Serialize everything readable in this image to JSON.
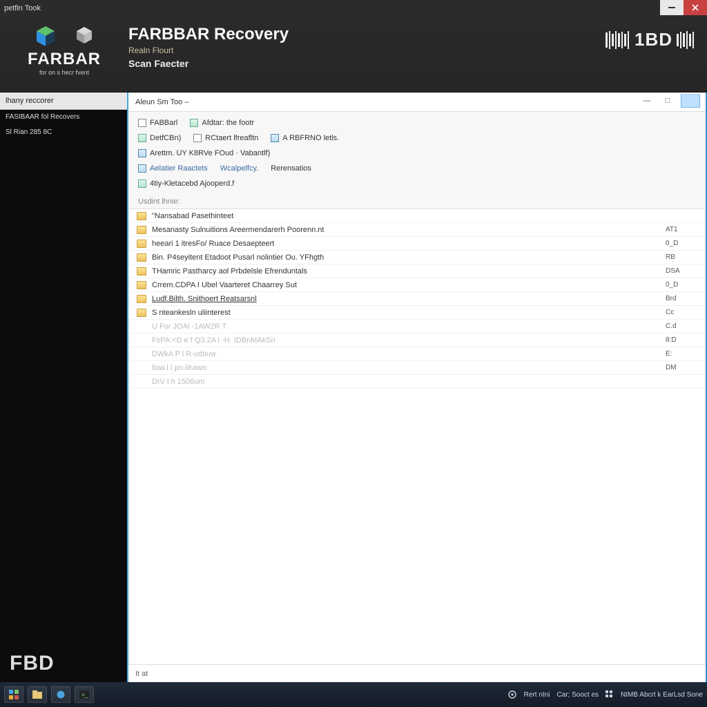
{
  "window": {
    "title": "petfin Took"
  },
  "header": {
    "logo_word": "FARBAR",
    "logo_sub": "for on s hecr fvent",
    "title": "FARBBAR Recovery",
    "subtitle1": "Realn Flourt",
    "subtitle2": "Scan Faecter",
    "right_logo_text": "1BD"
  },
  "sidebar": {
    "nav_label": "lhany reccorer",
    "sub1": "FASIBAAR fol Recovers",
    "sub2": "Sl Rian 285 8C",
    "footer_logo": "FBD"
  },
  "crumb": {
    "text": "Aleun Sm Too –"
  },
  "opt_rows": {
    "r1": [
      {
        "box": "plain",
        "label": "FABBarl"
      },
      {
        "box": "green",
        "label": "Afdtar: the footr"
      }
    ],
    "r2": [
      {
        "box": "green",
        "label": "DetfCBn)"
      },
      {
        "box": "plain",
        "label": "RCtaert lfreafltn"
      },
      {
        "box": "blue",
        "label": "A RBFRNO letls."
      }
    ],
    "r3": [
      {
        "box": "blue",
        "label": "Arettm. UY K8RVe FOud · Vabantlf)"
      }
    ],
    "r4": [
      {
        "box": "blue",
        "label": "Aelatier Raactets",
        "link": true
      },
      {
        "box": "none",
        "label": "Wcalpelfcy.",
        "link": true
      },
      {
        "box": "none",
        "label": "Rerensatios"
      }
    ],
    "r5": [
      {
        "box": "green",
        "label": "4tiy-Kletacebd  Ajooperd.f"
      }
    ]
  },
  "section_label": "Usdint lhnie:",
  "list": [
    {
      "name": "\"Nansabad Pasethinteet",
      "col": "",
      "faded": false
    },
    {
      "name": "Mesanasty Sulnuitions  Areermendarerh Poorenn.nt",
      "col": "AT1",
      "faded": false
    },
    {
      "name": "heeari 1 itresFo/ Ruace Desaepteert",
      "col": "0_D",
      "faded": false
    },
    {
      "name": "Bin.   P4seyitent Etadoot Pusarl nolintier Ou. YFhgth",
      "col": "RB",
      "faded": false
    },
    {
      "name": "THamric Pastharcy aol Prbdelsle Efrenduntals",
      "col": "DSA",
      "faded": false
    },
    {
      "name": "Crrem.CDPA I Ubel Vaarteret  Chaarrey Sut",
      "col": "0_D",
      "faded": false
    },
    {
      "name": "Ludf.Bilth. Snithoert Reatsarsnl",
      "col": "Brd",
      "faded": false,
      "underline": true
    },
    {
      "name": "S nteankesln uliinterest",
      "col": "Cc",
      "faded": false
    },
    {
      "name": "U For JOAl -1AW2R T",
      "col": "C.d",
      "faded": true,
      "noicon": true
    },
    {
      "name": "FsPA:<D e f    Q3.2A l  -H. IDBnMAkSn",
      "col": "8:D",
      "faded": true,
      "noicon": true
    },
    {
      "name": "                         DWkA P l        R-udtiuw",
      "col": "E:",
      "faded": true,
      "noicon": true
    },
    {
      "name": "                         llaw.l l         pn-lihawn",
      "col": "DM",
      "faded": true,
      "noicon": true
    },
    {
      "name": "                         DrV l h         1506um",
      "col": "",
      "faded": true,
      "noicon": true
    }
  ],
  "statusbar": {
    "text": "It at"
  },
  "taskbar": {
    "tray1": "Rert nIni",
    "tray2": "Car; Sooct es",
    "tray3": "NIMB Abcrt k EarLsd Sone"
  },
  "colors": {
    "accent": "#4aa3df"
  }
}
